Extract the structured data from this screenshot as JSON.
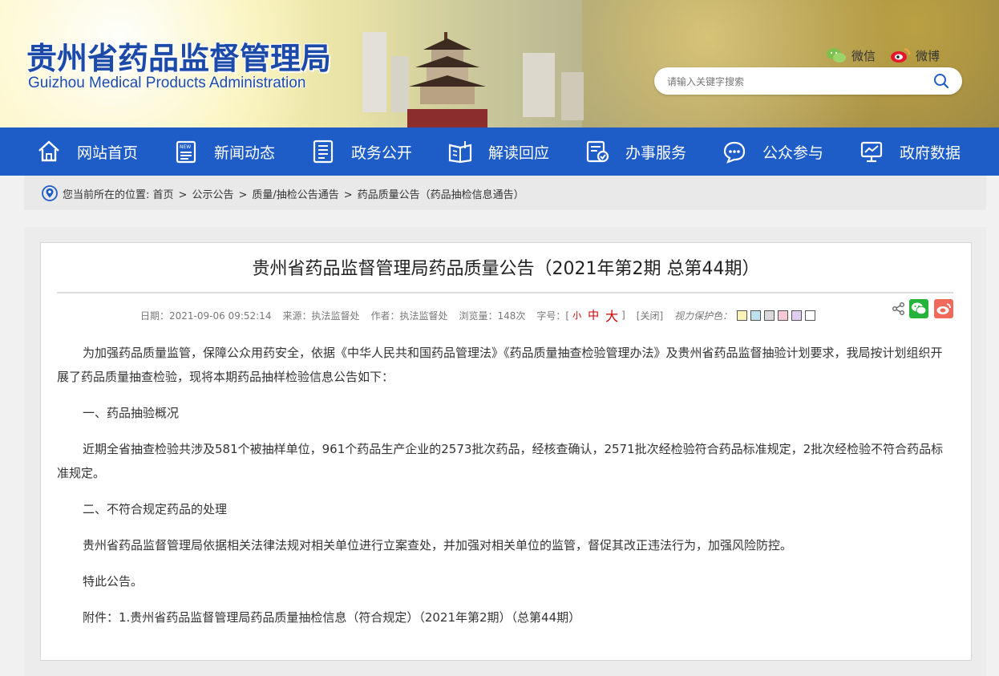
{
  "header": {
    "logo_cn": "贵州省药品监督管理局",
    "logo_en": "Guizhou Medical Products Administration",
    "wechat_label": "微信",
    "weibo_label": "微博",
    "search_placeholder": "请输入关键字搜索"
  },
  "nav": {
    "items": [
      {
        "label": "网站首页",
        "icon": "home-icon"
      },
      {
        "label": "新闻动态",
        "icon": "news-icon"
      },
      {
        "label": "政务公开",
        "icon": "document-icon"
      },
      {
        "label": "解读回应",
        "icon": "book-icon"
      },
      {
        "label": "办事服务",
        "icon": "service-icon"
      },
      {
        "label": "公众参与",
        "icon": "chat-icon"
      },
      {
        "label": "政府数据",
        "icon": "chart-icon"
      }
    ]
  },
  "breadcrumb": {
    "prefix": "您当前所在的位置:",
    "items": [
      "首页",
      "公示公告",
      "质量/抽检公告通告",
      "药品质量公告（药品抽检信息通告）"
    ],
    "separator": ">"
  },
  "article": {
    "title": "贵州省药品监督管理局药品质量公告（2021年第2期 总第44期）",
    "meta": {
      "date": "日期：2021-09-06 09:52:14",
      "source": "来源：执法监督处",
      "author": "作者：执法监督处",
      "views": "浏览量：148次",
      "font_label": "字号：[",
      "font_small": "小",
      "font_medium": "中",
      "font_large": "大",
      "font_close": "]",
      "close": "[关闭]",
      "protect_label": "视力保护色：",
      "protect_colors": [
        "#fbf3b8",
        "#bfe0ee",
        "#d9d9d9",
        "#f7c9d6",
        "#e0cdf0",
        "#ffffff"
      ]
    },
    "paragraphs": [
      "为加强药品质量监管，保障公众用药安全，依据《中华人民共和国药品管理法》《药品质量抽查检验管理办法》及贵州省药品监督抽验计划要求，我局按计划组织开展了药品质量抽查检验，现将本期药品抽样检验信息公告如下：",
      "一、药品抽验概况",
      "近期全省抽查检验共涉及581个被抽样单位，961个药品生产企业的2573批次药品，经核查确认，2571批次经检验符合药品标准规定，2批次经检验不符合药品标准规定。",
      "二、不符合规定药品的处理",
      "贵州省药品监督管理局依据相关法律法规对相关单位进行立案查处，并加强对相关单位的监管，督促其改正违法行为，加强风险防控。",
      "特此公告。",
      "附件：1.贵州省药品监督管理局药品质量抽检信息（符合规定）（2021年第2期）（总第44期）"
    ]
  },
  "colors": {
    "nav_bg": "#1e5cc8",
    "logo_blue": "#1c4aa8",
    "wechat_green": "#25b33c",
    "weibo_red": "#f06a5c",
    "font_red": "#cc0000"
  }
}
